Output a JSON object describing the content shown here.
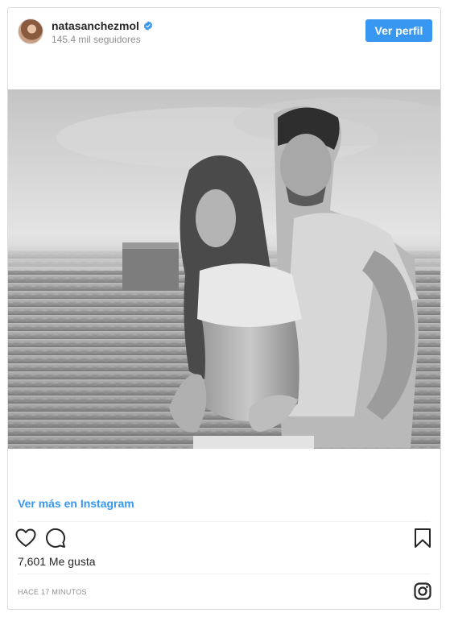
{
  "header": {
    "username": "natasanchezmol",
    "followers": "145.4 mil seguidores",
    "follow_button": "Ver perfil",
    "verified_icon": "verified-badge-icon"
  },
  "post": {
    "image_description": "black-and-white-couple-photo",
    "view_more": "Ver más en Instagram",
    "likes": "7,601 Me gusta",
    "timestamp": "HACE 17 MINUTOS"
  },
  "icons": {
    "like": "heart-icon",
    "comment": "comment-icon",
    "save": "bookmark-icon",
    "logo": "instagram-logo-icon"
  },
  "colors": {
    "accent": "#3897f0",
    "text": "#262626",
    "muted": "#8e8e8e",
    "border": "#dbdbdb"
  }
}
